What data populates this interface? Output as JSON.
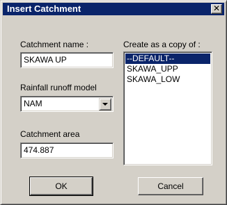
{
  "window": {
    "title": "Insert Catchment",
    "close_glyph": "✕"
  },
  "form": {
    "catchment_name_label": "Catchment name :",
    "catchment_name_value": "SKAWA UP",
    "rainfall_model_label": "Rainfall runoff model",
    "rainfall_model_value": "NAM",
    "catchment_area_label": "Catchment area",
    "catchment_area_value": "474.887",
    "copy_label": "Create as a copy of :"
  },
  "copy_list": {
    "items": [
      "--DEFAULT--",
      "SKAWA_UPP",
      "SKAWA_LOW"
    ],
    "selected_index": 0
  },
  "buttons": {
    "ok_label": "OK",
    "cancel_label": "Cancel"
  },
  "colors": {
    "titlebar": "#0a246a",
    "face": "#d4d0c8",
    "selection": "#0a246a"
  }
}
